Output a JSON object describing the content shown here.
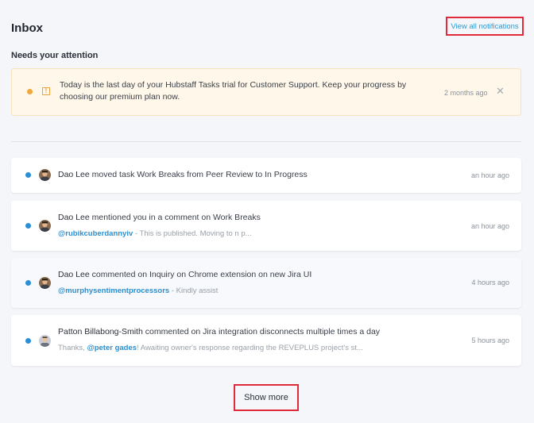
{
  "header": {
    "title": "Inbox",
    "view_all_label": "View all notifications"
  },
  "attention": {
    "heading": "Needs your attention",
    "alert": {
      "text": "Today is the last day of your Hubstaff Tasks trial for Customer Support. Keep your progress by choosing our premium plan now.",
      "time": "2 months ago",
      "close_glyph": "✕",
      "warning_glyph": "!"
    }
  },
  "notifications": [
    {
      "user": "Dao Lee",
      "action": "moved task Work Breaks from Peer Review to In Progress",
      "time": "an hour ago"
    },
    {
      "user": "Dao Lee",
      "action": "mentioned you in a comment on Work Breaks",
      "mention": "@rubikcuberdannyiv",
      "snippet": " - This is published. Moving to n p...",
      "time": "an hour ago"
    },
    {
      "user": "Dao Lee",
      "action": "commented on Inquiry on Chrome extension on new Jira UI",
      "mention": "@murphysentimentprocessors",
      "snippet": " - Kindly assist",
      "time": "4 hours ago"
    },
    {
      "user": "Patton Billabong-Smith",
      "action": "commented on Jira integration disconnects multiple times a day",
      "prefix": "Thanks, ",
      "mention": "@peter gades",
      "snippet": "! Awaiting owner's response regarding the REVEPLUS project's st...",
      "time": "5 hours ago"
    }
  ],
  "footer": {
    "show_more_label": "Show more"
  },
  "colors": {
    "accent": "#2a9ad6",
    "unread_dot": "#2b8fd6",
    "warning": "#f0a73b"
  }
}
